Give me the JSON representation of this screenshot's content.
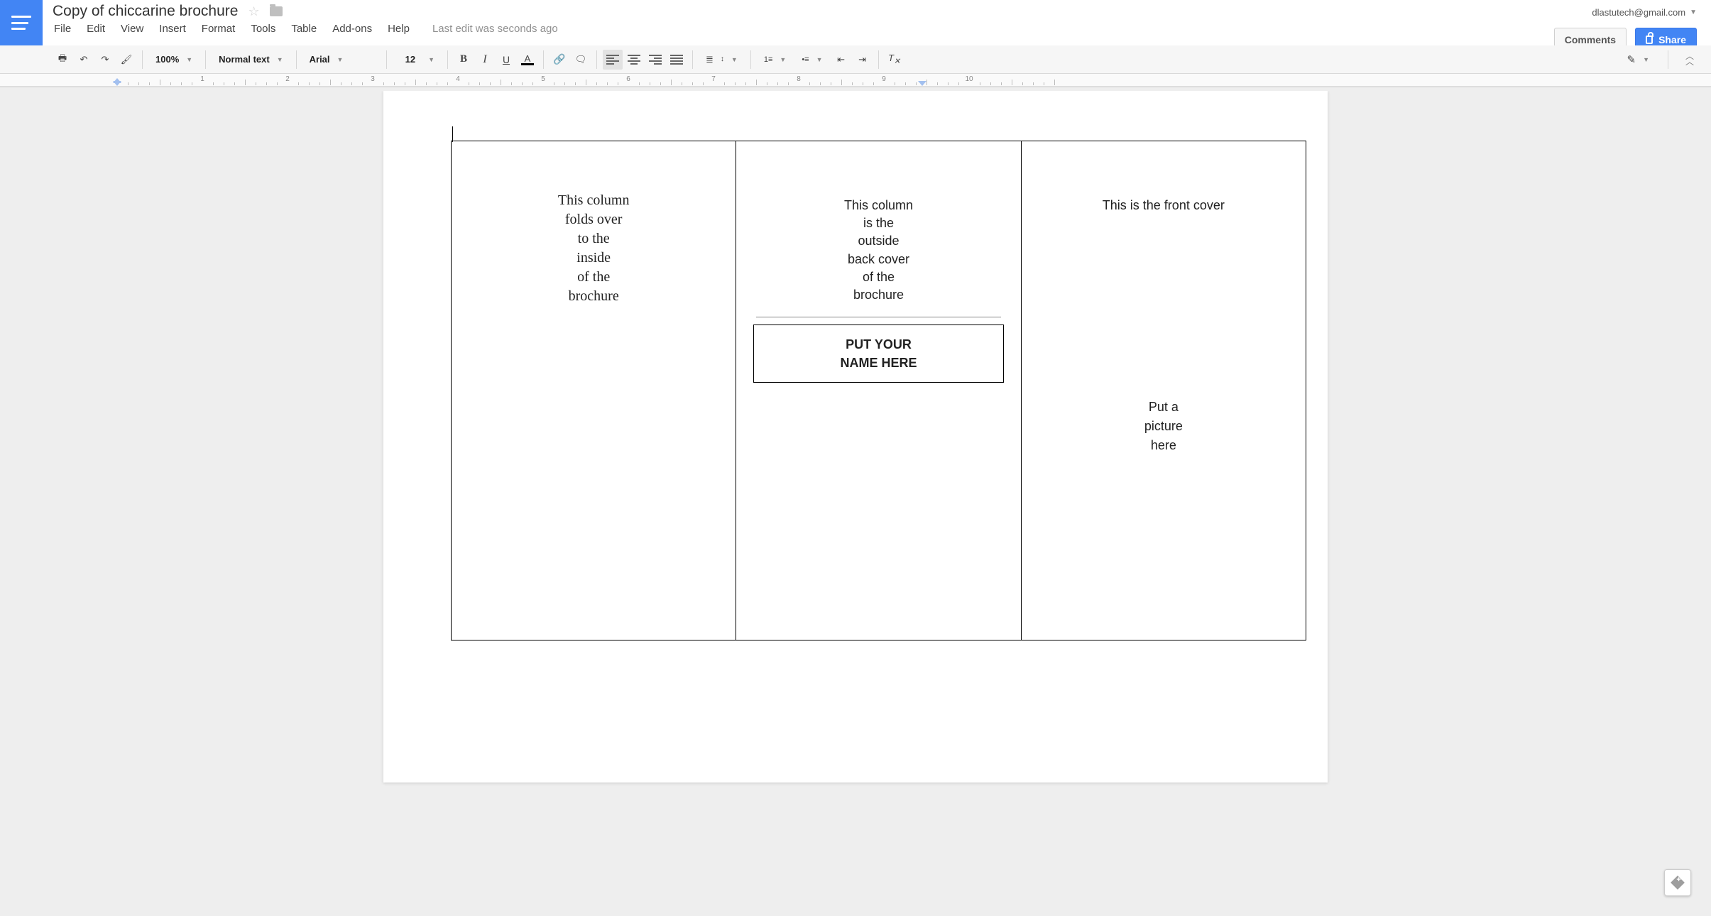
{
  "header": {
    "doc_title": "Copy of chiccarine brochure",
    "user_email": "dlastutech@gmail.com",
    "comments_label": "Comments",
    "share_label": "Share",
    "last_edit": "Last edit was seconds ago"
  },
  "menu": {
    "file": "File",
    "edit": "Edit",
    "view": "View",
    "insert": "Insert",
    "format": "Format",
    "tools": "Tools",
    "table": "Table",
    "addons": "Add-ons",
    "help": "Help"
  },
  "toolbar": {
    "zoom": "100%",
    "style": "Normal text",
    "font": "Arial",
    "size": "12",
    "bold": "B",
    "italic": "I",
    "underline": "U",
    "text_color": "A"
  },
  "ruler": {
    "numbers": [
      "1",
      "2",
      "3",
      "4",
      "5",
      "6",
      "7",
      "8",
      "9",
      "10"
    ]
  },
  "document": {
    "col1": "This column\nfolds over\nto the\ninside\nof the\nbrochure",
    "col2_top": "This column\nis the\noutside\nback cover\nof the\nbrochure",
    "col2_box": "PUT YOUR\nNAME HERE",
    "col3_title": "This is the front cover",
    "col3_pic": "Put a\npicture\nhere"
  }
}
